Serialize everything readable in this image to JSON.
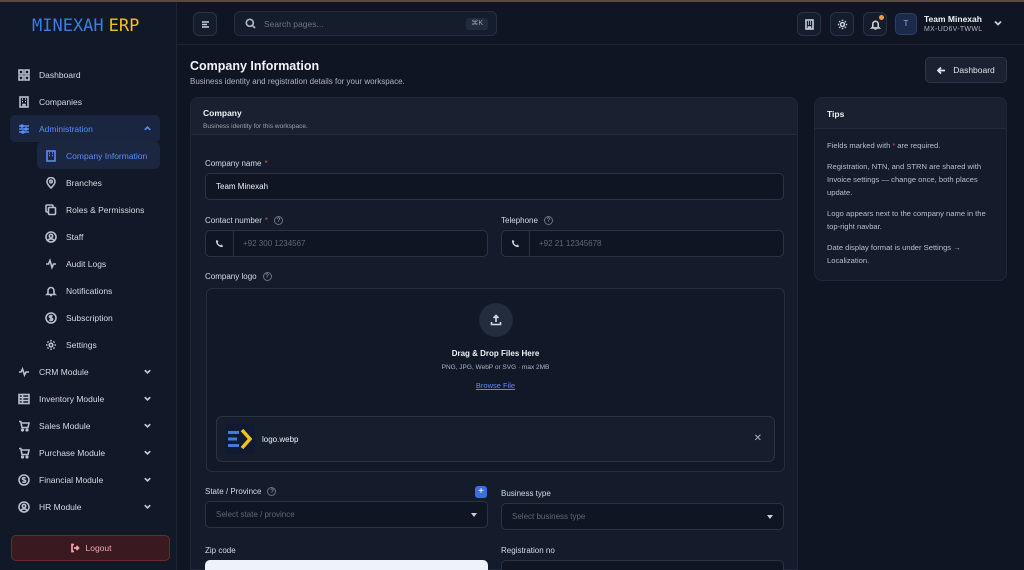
{
  "brand": {
    "part1": "MINEXAH",
    "part2": "ERP"
  },
  "sidebar": {
    "items": [
      {
        "label": "Dashboard",
        "icon": "grid-icon"
      },
      {
        "label": "Companies",
        "icon": "building-icon"
      },
      {
        "label": "Administration",
        "icon": "sliders-icon"
      }
    ],
    "admin_sub": [
      {
        "label": "Company Information",
        "icon": "building-icon"
      },
      {
        "label": "Branches",
        "icon": "pin-icon"
      },
      {
        "label": "Roles & Permissions",
        "icon": "copy-icon"
      },
      {
        "label": "Staff",
        "icon": "user-circle-icon"
      },
      {
        "label": "Audit Logs",
        "icon": "activity-icon"
      },
      {
        "label": "Notifications",
        "icon": "bell-icon"
      },
      {
        "label": "Subscription",
        "icon": "coin-icon"
      },
      {
        "label": "Settings",
        "icon": "gear-icon"
      }
    ],
    "modules": [
      {
        "label": "CRM Module",
        "icon": "pulse-icon"
      },
      {
        "label": "Inventory Module",
        "icon": "table-icon"
      },
      {
        "label": "Sales Module",
        "icon": "cart-icon"
      },
      {
        "label": "Purchase Module",
        "icon": "cart-icon"
      },
      {
        "label": "Financial Module",
        "icon": "dollar-icon"
      },
      {
        "label": "HR Module",
        "icon": "user-circle-icon"
      }
    ],
    "logout_label": "Logout"
  },
  "topbar": {
    "search_placeholder": "Search pages...",
    "search_shortcut": "⌘K",
    "user_name": "Team Minexah",
    "user_code": "MX-UD6V-TWWL",
    "avatar_initial": "T"
  },
  "page": {
    "title": "Company Information",
    "subtitle": "Business identity and registration details for your workspace.",
    "back_label": "Dashboard"
  },
  "card": {
    "title": "Company",
    "subtitle": "Business identity for this workspace."
  },
  "form": {
    "company_name_label": "Company name",
    "company_name_value": "Team Minexah",
    "contact_label": "Contact number",
    "contact_placeholder": "+92 300 1234567",
    "telephone_label": "Telephone",
    "telephone_placeholder": "+92 21 12345678",
    "logo_label": "Company logo",
    "drop_title": "Drag & Drop Files Here",
    "drop_sub": "PNG, JPG, WebP or SVG · max 2MB",
    "browse_label": "Browse File",
    "file_name": "logo.webp",
    "state_label": "State / Province",
    "state_placeholder": "Select state / province",
    "business_type_label": "Business type",
    "business_type_placeholder": "Select business type",
    "zip_label": "Zip code",
    "registration_label": "Registration no"
  },
  "tips": {
    "title": "Tips",
    "tip1_a": "Fields marked with",
    "tip1_star": "*",
    "tip1_b": "are required.",
    "tip2": "Registration, NTN, and STRN are shared with Invoice settings — change once, both places update.",
    "tip3": "Logo appears next to the company name in the top-right navbar.",
    "tip4": "Date display format is under Settings → Localization."
  },
  "colors": {
    "accent": "#5b8cf5",
    "danger": "#e5484d",
    "background": "#0f1523"
  }
}
